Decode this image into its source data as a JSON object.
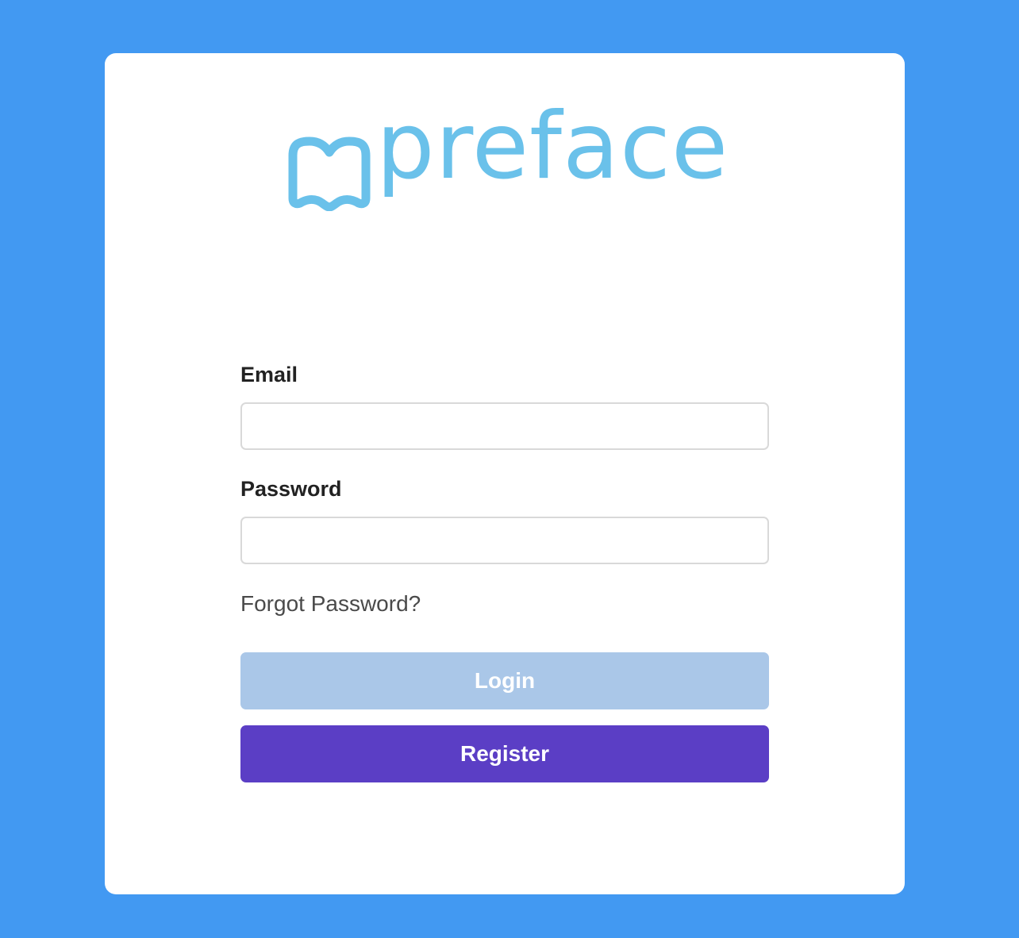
{
  "brand": {
    "name": "preface",
    "color": "#6ac1ea"
  },
  "form": {
    "email_label": "Email",
    "email_value": "",
    "password_label": "Password",
    "password_value": "",
    "forgot_link": "Forgot Password?"
  },
  "buttons": {
    "login_label": "Login",
    "register_label": "Register"
  },
  "colors": {
    "background": "#4299f2",
    "login_button": "#aac7e8",
    "register_button": "#5b3ec5"
  }
}
